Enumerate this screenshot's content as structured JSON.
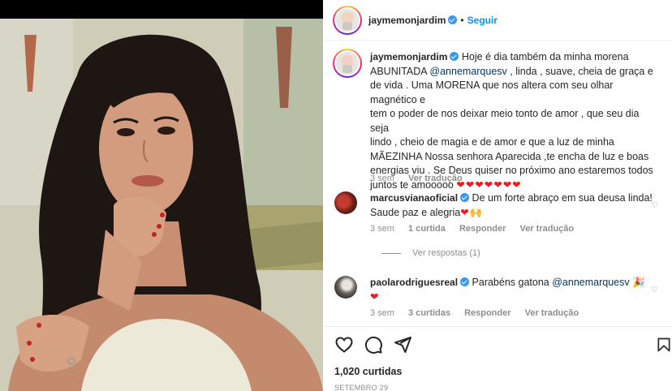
{
  "post": {
    "author": "jaymemonjardim",
    "follow_label": "Seguir",
    "dot": "•",
    "caption_author": "jaymemonjardim",
    "caption_line1_prefix": "Hoje é dia também da minha morena",
    "caption_line2_a": "ABUNITADA ",
    "caption_mention": "@annemarquesv",
    "caption_line2_b": " , linda , suave, cheia de graça e",
    "caption_line3": "de vida . Uma MORENA que nos altera com seu olhar magnético e",
    "caption_line4": "tem o poder de nos deixar meio tonto de amor , que seu dia seja",
    "caption_line5": "lindo , cheio de magia e de amor e que a luz de minha",
    "caption_line6": "MÃEZINHA Nossa senhora Aparecida ,te encha de luz e boas",
    "caption_line7": "energias viu . Se Deus quiser no próximo ano estaremos todos",
    "caption_line8": "juntos te amooooo",
    "caption_hearts": "❤❤❤❤❤❤❤",
    "caption_time": "3 sem",
    "caption_translate": "Ver tradução"
  },
  "comments": [
    {
      "user": "marcusvianaoficial",
      "line1": "De um forte abraço em sua deusa linda!",
      "line2": "Saude paz e alegria",
      "emoji": "❤🙌",
      "time": "3 sem",
      "likes": "1 curtida",
      "reply": "Responder",
      "translate": "Ver tradução",
      "view_replies": "Ver respostas (1)"
    },
    {
      "user": "paolarodriguesreal",
      "line1": "Parabéns gatona ",
      "mention": "@annemarquesv",
      "emoji": "🎉",
      "line2": "❤",
      "time": "3 sem",
      "likes": "3 curtidas",
      "reply": "Responder",
      "translate": "Ver tradução"
    }
  ],
  "footer": {
    "likes": "1,020 curtidas",
    "date": "SETEMBRO 29"
  },
  "icons": {
    "like": "heart-outline-icon",
    "comment": "comment-bubble-icon",
    "share": "paper-plane-icon",
    "save": "bookmark-icon"
  },
  "colors": {
    "accent": "#0095f6",
    "verified": "#3897f0",
    "muted": "#8e8e8e",
    "heart": "#ed1c24"
  }
}
